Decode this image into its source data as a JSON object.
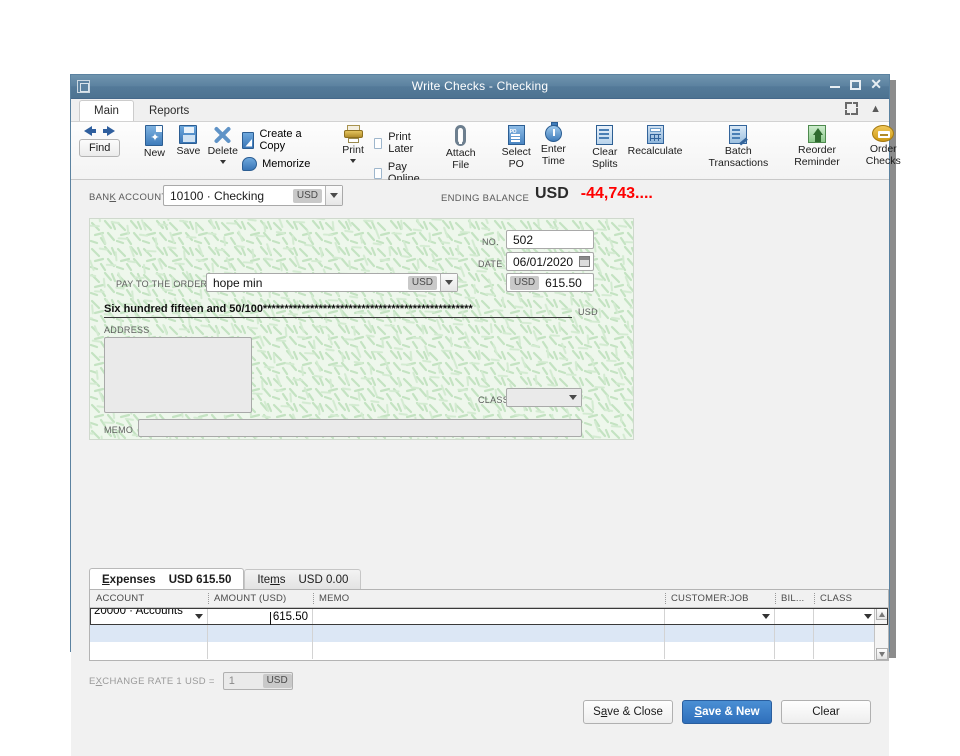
{
  "window": {
    "title": "Write Checks - Checking",
    "sysmenu_icon": "window-menu-icon",
    "minimize": "minimize-icon",
    "maximize": "maximize-icon",
    "close": "close-icon"
  },
  "ribbon_tabs": [
    {
      "label": "Main",
      "active": true
    },
    {
      "label": "Reports",
      "active": false
    }
  ],
  "ribbon_controls": {
    "expand": "expand-icon",
    "collapse": "chevron-up-icon"
  },
  "toolbar": {
    "find": "Find",
    "prev_icon": "arrow-left-icon",
    "next_icon": "arrow-right-icon",
    "new": "New",
    "save": "Save",
    "delete": "Delete",
    "create_a_copy": "Create a Copy",
    "memorize": "Memorize",
    "print": "Print",
    "print_later": "Print Later",
    "pay_online": "Pay Online",
    "attach_file_1": "Attach",
    "attach_file_2": "File",
    "select_po_1": "Select",
    "select_po_2": "PO",
    "enter_time_1": "Enter",
    "enter_time_2": "Time",
    "clear_splits_1": "Clear",
    "clear_splits_2": "Splits",
    "recalculate": "Recalculate",
    "batch_1": "Batch",
    "batch_2": "Transactions",
    "reorder_1": "Reorder",
    "reorder_2": "Reminder",
    "order_checks_1": "Order",
    "order_checks_2": "Checks"
  },
  "bank_row": {
    "bank_account_label": "BANK ACCOUNT",
    "bank_account_value": "10100 · Checking",
    "bank_account_currency": "USD",
    "ending_balance_label": "ENDING BALANCE",
    "ending_balance_currency": "USD",
    "ending_balance_value": "-44,743....",
    "ending_balance_color": "#ff0000"
  },
  "check": {
    "no_label": "NO.",
    "no_value": "502",
    "date_label": "DATE",
    "date_value": "06/01/2020",
    "calendar_icon": "calendar-icon",
    "pay_to_label": "PAY TO THE ORDER OF",
    "pay_to_value": "hope min",
    "pay_to_currency": "USD",
    "amount_currency": "USD",
    "amount_value": "615.50",
    "amount_words": "Six hundred fifteen and 50/100*************************************************",
    "amount_words_currency": "USD",
    "address_label": "ADDRESS",
    "address_value": "",
    "class_label": "CLASS",
    "class_value": "",
    "memo_label": "MEMO",
    "memo_value": ""
  },
  "detail_tabs": [
    {
      "label": "Expenses",
      "amount": "USD 615.50",
      "active": true
    },
    {
      "label": "Items",
      "amount": "USD 0.00",
      "active": false
    }
  ],
  "grid": {
    "columns": [
      "ACCOUNT",
      "AMOUNT (USD)",
      "MEMO",
      "CUSTOMER:JOB",
      "BIL...",
      "CLASS"
    ],
    "rows": [
      {
        "account": "20000 · Accounts ...",
        "amount": "615.50",
        "memo": "",
        "customer_job": "",
        "billable": "",
        "class": ""
      },
      {
        "account": "",
        "amount": "",
        "memo": "",
        "customer_job": "",
        "billable": "",
        "class": ""
      },
      {
        "account": "",
        "amount": "",
        "memo": "",
        "customer_job": "",
        "billable": "",
        "class": ""
      }
    ],
    "scroll_up_icon": "scroll-up-icon",
    "scroll_down_icon": "scroll-down-icon"
  },
  "exchange_rate": {
    "label": "EXCHANGE RATE 1 USD =",
    "value": "1",
    "currency": "USD"
  },
  "actions": {
    "save_close": "Save & Close",
    "save_new": "Save & New",
    "clear": "Clear"
  }
}
